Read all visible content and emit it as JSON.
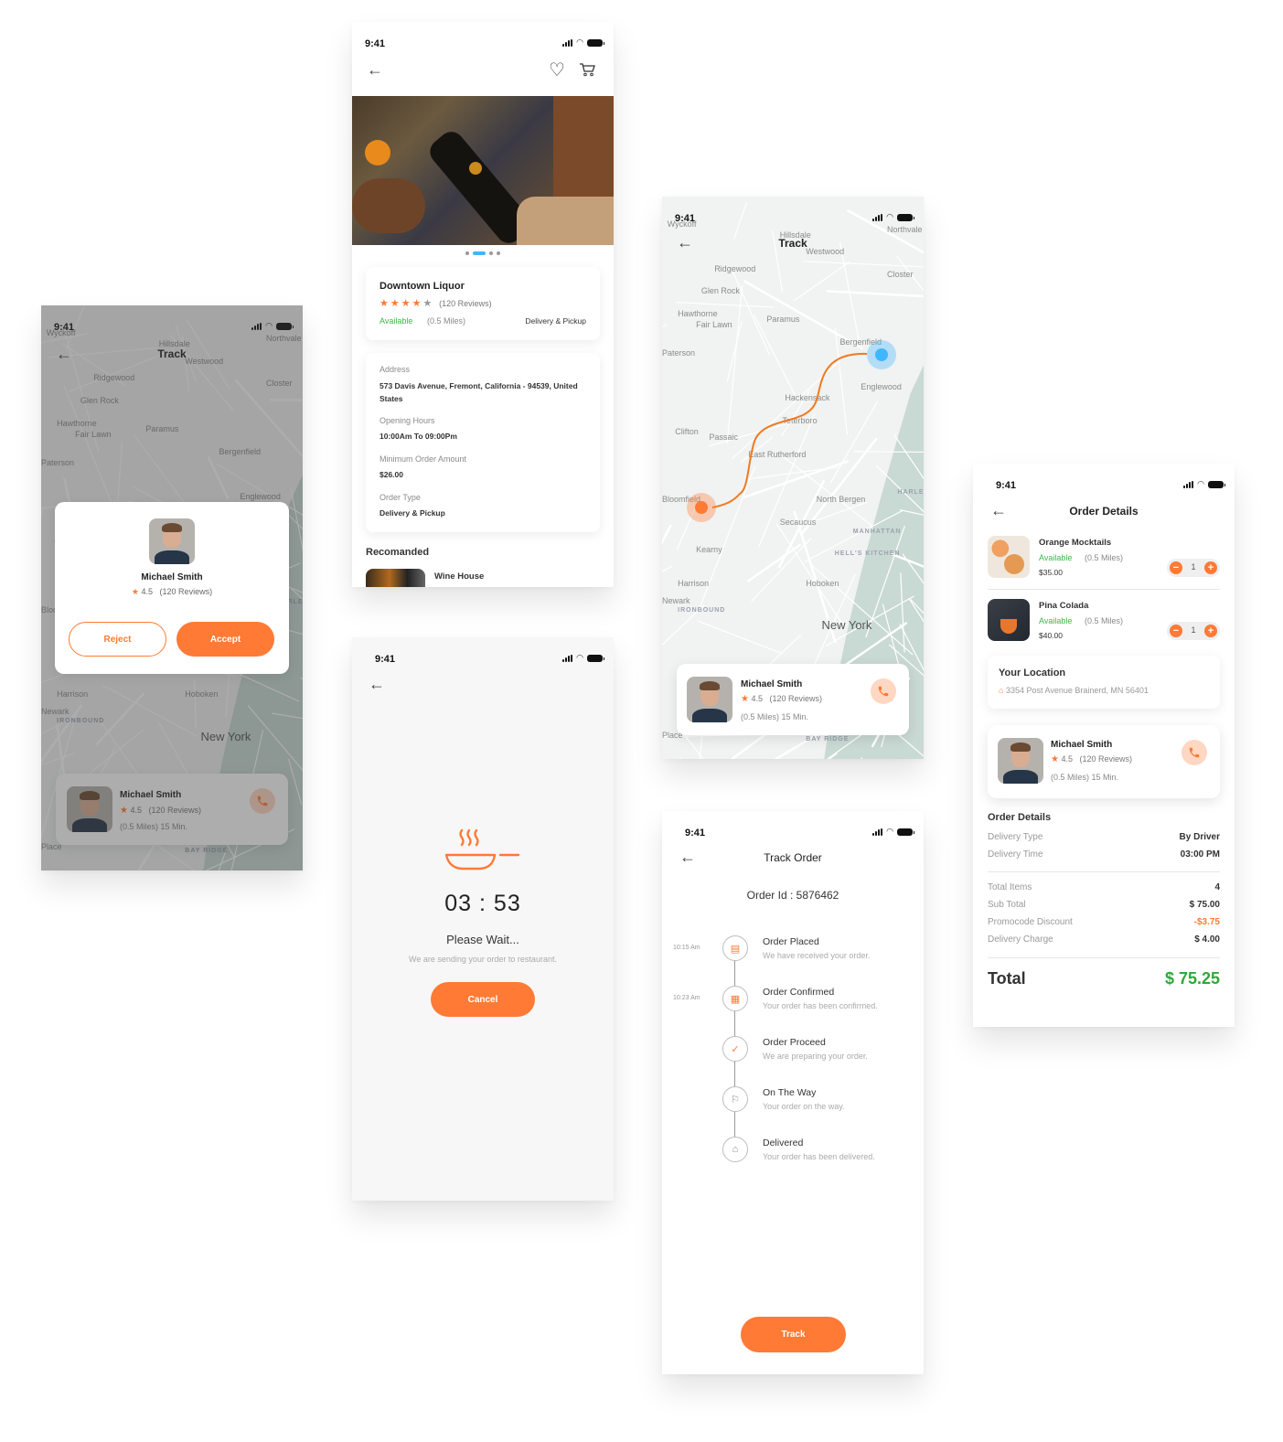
{
  "status_time": "9:41",
  "colors": {
    "accent": "#ff7a35",
    "available": "#3db54a",
    "location_pin": "#3fb6ff",
    "total": "#2fa83b"
  },
  "icons": {
    "back": "←",
    "heart": "♡",
    "star": "★",
    "home": "⌂",
    "phone": "phone-icon",
    "check": "✓"
  },
  "store_screen": {
    "store_name": "Downtown Liquor",
    "rating_stars": 4,
    "rating_max": 5,
    "reviews": "(120 Reviews)",
    "availability": "Available",
    "distance": "(0.5 Miles)",
    "order_modes": "Delivery & Pickup",
    "carousel_pages": 4,
    "carousel_active": 2,
    "details": [
      {
        "label": "Address",
        "value": "573 Davis Avenue, Fremont, California - 94539, United States"
      },
      {
        "label": "Opening Hours",
        "value": "10:00Am To 09:00Pm"
      },
      {
        "label": "Minimum Order Amount",
        "value": "$26.00"
      },
      {
        "label": "Order Type",
        "value": "Delivery & Pickup"
      }
    ],
    "recommended_heading": "Recomanded",
    "recommended_items": [
      {
        "name": "Wine House"
      }
    ]
  },
  "request_screen": {
    "title": "Track",
    "driver_name": "Michael Smith",
    "rating": "4.5",
    "reviews": "(120 Reviews)",
    "reject_label": "Reject",
    "accept_label": "Accept",
    "card_meta": "(0.5 Miles)   15 Min."
  },
  "track_map_screen": {
    "title": "Track",
    "driver_name": "Michael Smith",
    "rating": "4.5",
    "reviews": "(120 Reviews)",
    "meta": "(0.5 Miles)   15 Min."
  },
  "map_labels": [
    "Wyckoff",
    "Hillsdale",
    "Westwood",
    "Northvale",
    "Ridgewood",
    "Closter",
    "Glen Rock",
    "Hawthorne",
    "Fair Lawn",
    "Paramus",
    "Bergenfield",
    "Paterson",
    "Englewood",
    "Hackensack",
    "Teterboro",
    "Clifton",
    "Passaic",
    "East Rutherford",
    "North Bergen",
    "Secaucus",
    "MANHATTAN",
    "HARLEM",
    "HELL'S KITCHEN",
    "Kearny",
    "Harrison",
    "Newark",
    "IRONBOUND",
    "Hoboken",
    "New York",
    "BAY RIDGE",
    "Place",
    "Bloomfield"
  ],
  "wait_screen": {
    "timer": "03 : 53",
    "heading": "Please Wait...",
    "message": "We are sending your order to restaurant.",
    "cancel_label": "Cancel"
  },
  "track_order_screen": {
    "title": "Track Order",
    "order_id": "Order Id : 5876462",
    "steps": [
      {
        "time": "10:15 Am",
        "title": "Order Placed",
        "subtitle": "We have received your order.",
        "active": true
      },
      {
        "time": "10:23 Am",
        "title": "Order Confirmed",
        "subtitle": "Your order has been confirmed.",
        "active": true
      },
      {
        "time": "",
        "title": "Order Proceed",
        "subtitle": "We are preparing your order.",
        "active": true
      },
      {
        "time": "",
        "title": "On The Way",
        "subtitle": "Your order on the way.",
        "active": false
      },
      {
        "time": "",
        "title": "Delivered",
        "subtitle": "Your order has been delivered.",
        "active": false
      }
    ],
    "track_label": "Track"
  },
  "order_details_screen": {
    "title": "Order Details",
    "items": [
      {
        "name": "Orange Mocktails",
        "availability": "Available",
        "distance": "(0.5 Miles)",
        "price": "$35.00",
        "qty": "1"
      },
      {
        "name": "Pina Colada",
        "availability": "Available",
        "distance": "(0.5 Miles)",
        "price": "$40.00",
        "qty": "1"
      }
    ],
    "location_heading": "Your Location",
    "location_address": "3354 Post Avenue Brainerd, MN 56401",
    "driver": {
      "name": "Michael Smith",
      "rating": "4.5",
      "reviews": "(120 Reviews)",
      "meta": "(0.5 Miles)   15 Min."
    },
    "section_heading": "Order Details",
    "delivery_rows": [
      {
        "label": "Delivery Type",
        "value": "By Driver"
      },
      {
        "label": "Delivery Time",
        "value": "03:00 PM"
      }
    ],
    "cost_rows": [
      {
        "label": "Total Items",
        "value": "4"
      },
      {
        "label": "Sub Total",
        "value": "$ 75.00"
      },
      {
        "label": "Promocode Discount",
        "value": "-$3.75"
      },
      {
        "label": "Delivery Charge",
        "value": "$ 4.00"
      }
    ],
    "total_label": "Total",
    "total_value": "$ 75.25"
  }
}
